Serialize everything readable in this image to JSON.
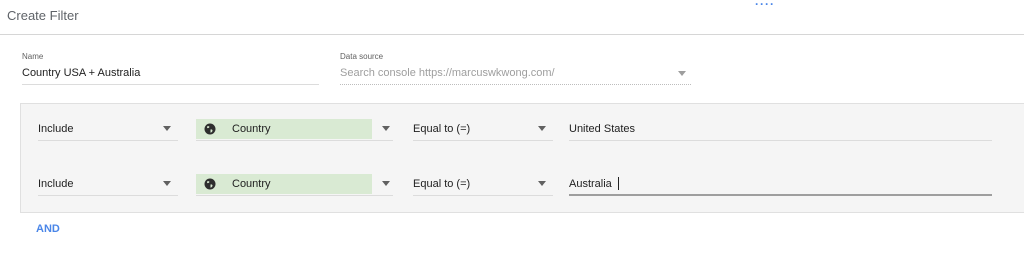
{
  "header": {
    "title": "Create Filter",
    "indicator": "····"
  },
  "name_field": {
    "label": "Name",
    "value": "Country USA + Australia"
  },
  "data_source_field": {
    "label": "Data source",
    "placeholder": "Search console https://marcuswkwong.com/"
  },
  "conditions": [
    {
      "type": "Include",
      "dimension": "Country",
      "operator": "Equal to (=)",
      "value": "United States"
    },
    {
      "type": "Include",
      "dimension": "Country",
      "operator": "Equal to (=)",
      "value": "Australia"
    }
  ],
  "and_label": "AND",
  "colors": {
    "accent": "#4a86e8",
    "dimension_chip": "#d9ead3",
    "panel": "#f5f5f5"
  },
  "icons": {
    "dimension": "globe-icon",
    "dropdown": "chevron-down-icon"
  }
}
